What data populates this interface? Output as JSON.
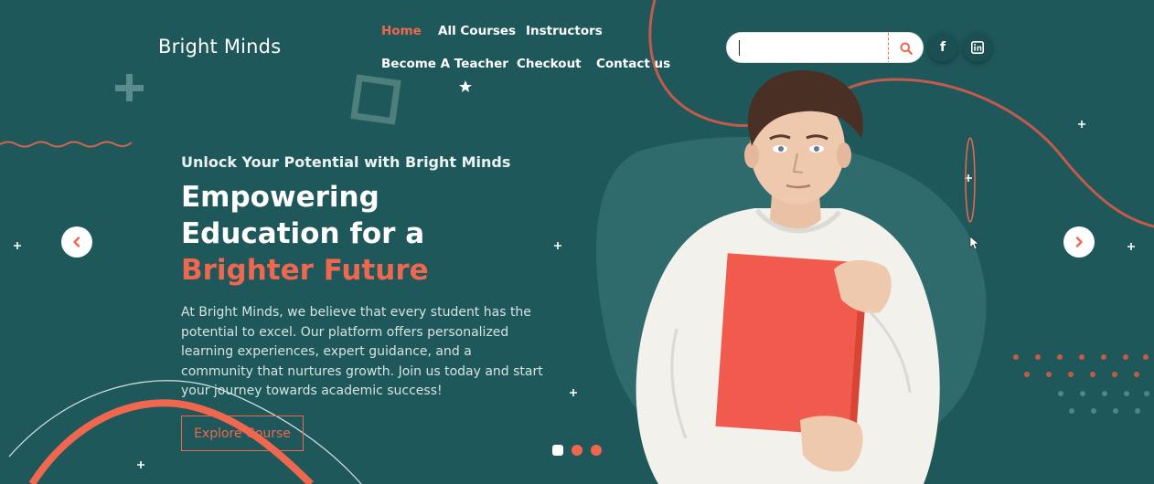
{
  "brand": {
    "name": "Bright Minds"
  },
  "nav": {
    "items": [
      {
        "label": "Home",
        "active": true
      },
      {
        "label": "All Courses",
        "active": false
      },
      {
        "label": "Instructors",
        "active": false
      },
      {
        "label": "Become A Teacher",
        "active": false
      },
      {
        "label": "Checkout",
        "active": false
      },
      {
        "label": "Contact us",
        "active": false
      }
    ]
  },
  "search": {
    "value": "",
    "placeholder": ""
  },
  "social": [
    {
      "icon": "facebook-icon",
      "glyph": "f"
    },
    {
      "icon": "linkedin-icon",
      "glyph": "in"
    }
  ],
  "hero": {
    "eyebrow": "Unlock Your Potential with Bright Minds",
    "headline_line1": "Empowering",
    "headline_line2": "Education for a",
    "headline_accent": "Brighter Future",
    "description": "At Bright Minds, we believe that every student has the potential to excel. Our platform offers personalized learning experiences, expert guidance, and a community that nurtures growth. Join us today and start your journey towards academic success!",
    "cta_label": "Explore Course"
  },
  "carousel": {
    "prev_icon": "chevron-left-icon",
    "next_icon": "chevron-right-icon",
    "slides_count": 3,
    "active_index": 0
  },
  "colors": {
    "background": "#1f585b",
    "accent": "#f0674f",
    "text": "#ffffff"
  }
}
